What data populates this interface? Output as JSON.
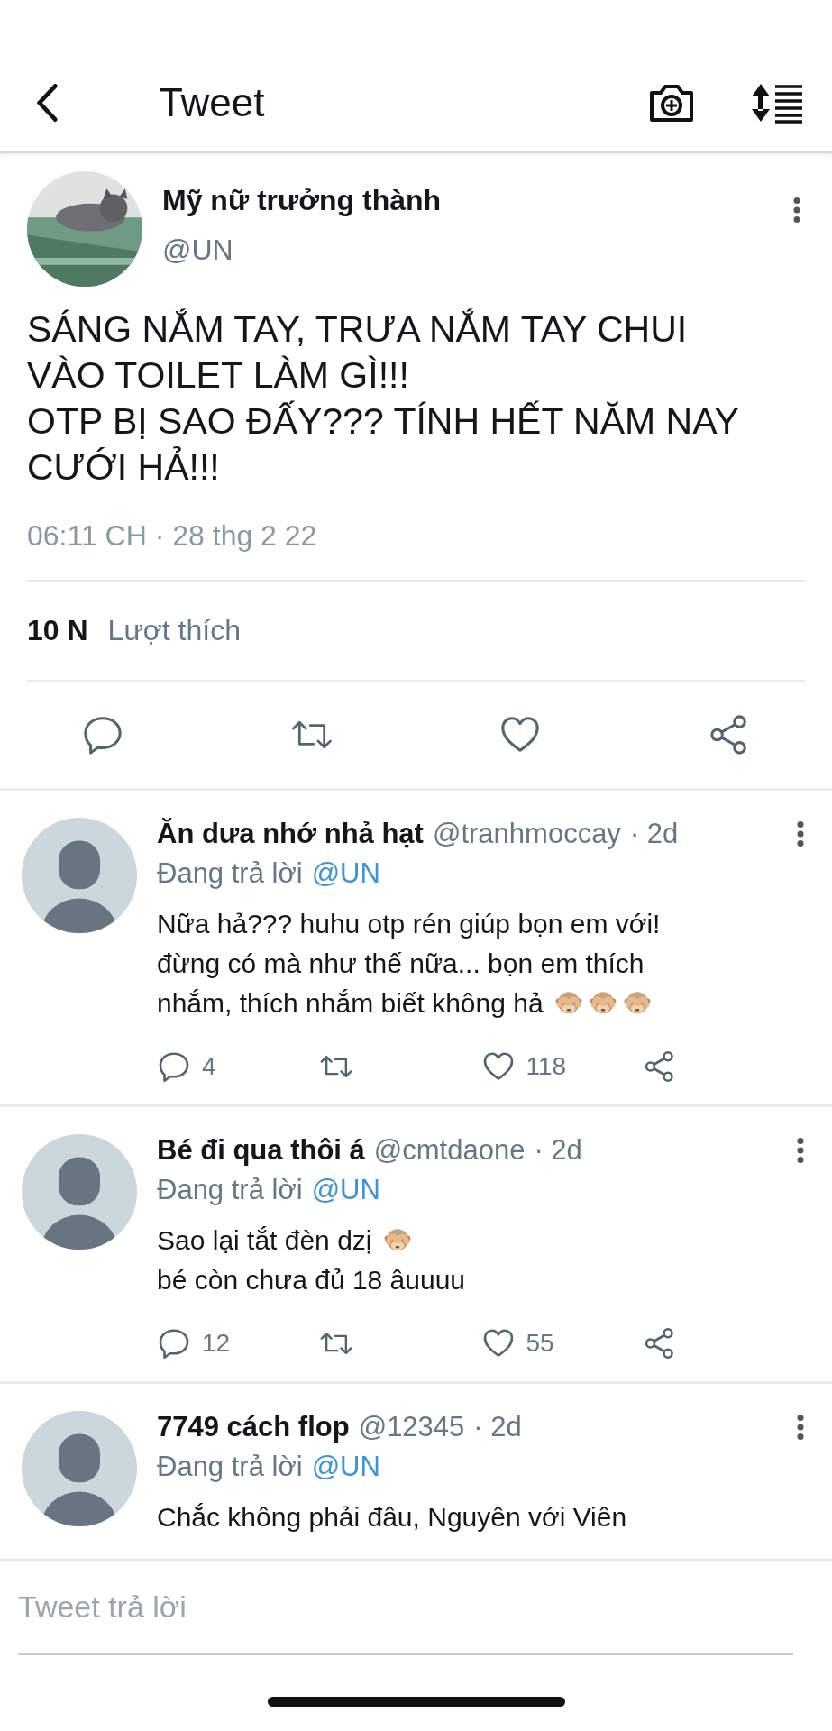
{
  "header": {
    "title": "Tweet"
  },
  "tweet": {
    "author": "Mỹ nữ trưởng thành",
    "handle": "@UN",
    "lines": [
      "SÁNG NẮM TAY, TRƯA NẮM TAY CHUI",
      "VÀO TOILET LÀM GÌ!!!",
      "OTP BỊ SAO ĐẤY??? TÍNH HẾT NĂM NAY",
      "CƯỚI HẢ!!!"
    ],
    "timestamp": "06:11 CH · 28 thg 2 22",
    "likes_count": "10 N",
    "likes_label": "Lượt thích"
  },
  "replies": [
    {
      "name": "Ăn dưa nhớ nhả hạt",
      "handle": "@tranhmoccay",
      "age": "· 2d",
      "replying_label": "Đang trả lời",
      "replying_to": "@UN",
      "lines": [
        {
          "text": "Nữa hả??? huhu otp rén giúp bọn em với!"
        },
        {
          "text": "đừng có mà như thế nữa... bọn em thích"
        },
        {
          "text": "nhắm, thích nhắm biết không hả",
          "emoji": [
            {
              "kind": "monkey"
            },
            {
              "kind": "monkey"
            },
            {
              "kind": "monkey"
            }
          ]
        }
      ],
      "stats": {
        "replies": "4",
        "likes": "118"
      }
    },
    {
      "name": "Bé đi qua thôi á",
      "handle": "@cmtdaone",
      "age": "· 2d",
      "replying_label": "Đang trả lời",
      "replying_to": "@UN",
      "lines": [
        {
          "text": "Sao lại tắt đèn dzị",
          "emoji": [
            {
              "kind": "monkey"
            }
          ]
        },
        {
          "text": "bé còn chưa đủ 18 âuuuu"
        }
      ],
      "stats": {
        "replies": "12",
        "likes": "55"
      }
    },
    {
      "name": "7749 cách flop",
      "handle": "@12345",
      "age": "· 2d",
      "replying_label": "Đang trả lời",
      "replying_to": "@UN",
      "lines": [
        {
          "text": "Chắc không phải đâu, Nguyên với Viên"
        }
      ]
    }
  ],
  "composer": {
    "placeholder": "Tweet trả lời"
  }
}
